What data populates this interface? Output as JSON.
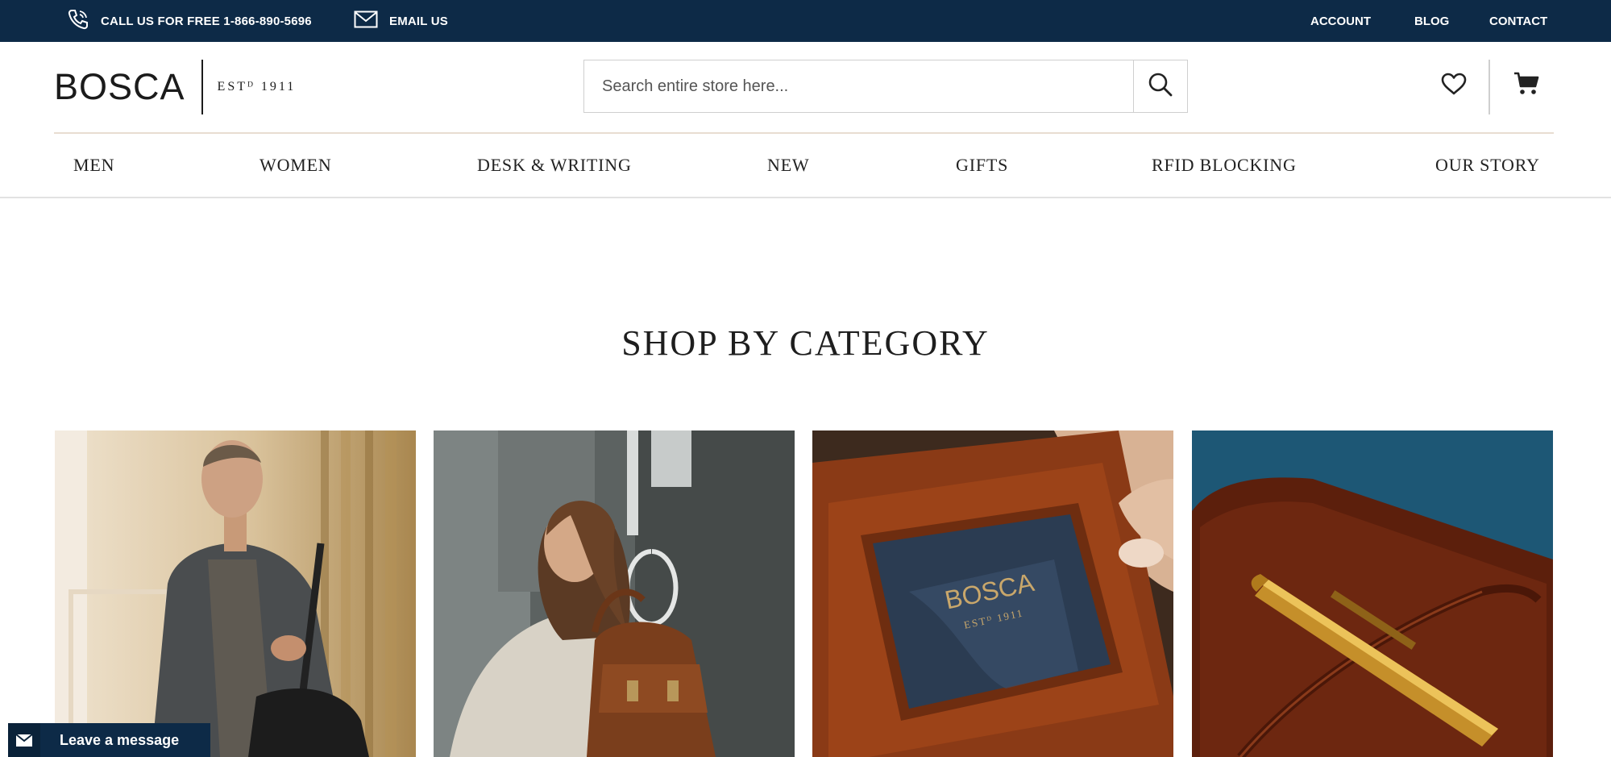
{
  "topbar": {
    "phone_icon": "phone-icon",
    "phone_label": "CALL US FOR FREE 1-866-890-5696",
    "email_icon": "envelope-icon",
    "email_label": "EMAIL US",
    "links": {
      "account": "ACCOUNT",
      "blog": "BLOG",
      "contact": "CONTACT"
    },
    "background": "#0d2a47"
  },
  "header": {
    "logo_word": "BOSCA",
    "logo_est": "ESTᴰ 1911",
    "search": {
      "placeholder": "Search entire store here...",
      "value": "",
      "button_icon": "search-icon"
    },
    "wishlist_icon": "heart-icon",
    "cart_icon": "cart-icon"
  },
  "nav": {
    "items": [
      "MEN",
      "WOMEN",
      "DESK & WRITING",
      "NEW",
      "GIFTS",
      "RFID BLOCKING",
      "OUR STORY"
    ]
  },
  "main": {
    "section_title": "SHOP BY CATEGORY",
    "tiles": [
      {
        "subject": "man-with-leather-bag-photo"
      },
      {
        "subject": "woman-with-backpack-photo"
      },
      {
        "subject": "leather-id-wallet-photo",
        "wallet_text_1": "BOSCA",
        "wallet_text_2": "ESTᴰ 1911"
      },
      {
        "subject": "leather-journal-and-gold-pen-photo"
      }
    ]
  },
  "chat_widget": {
    "icon": "envelope-icon",
    "label": "Leave a message"
  }
}
